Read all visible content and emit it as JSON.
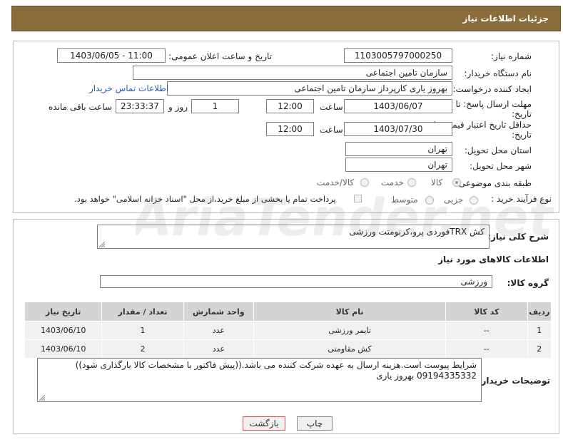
{
  "header": {
    "title": "جزئیات اطلاعات نیاز"
  },
  "form": {
    "need_number_label": "شماره نیاز:",
    "need_number": "1103005797000250",
    "announce_label": "تاریخ و ساعت اعلان عمومی:",
    "announce_value": "1403/06/05 - 11:00",
    "buyer_org_label": "نام دستگاه خریدار:",
    "buyer_org": "سازمان تامین اجتماعی",
    "requester_label": "ایجاد کننده درخواست:",
    "requester": "بهروز یاری کارپرداز سازمان تامین اجتماعی",
    "contact_link": "اطلاعات تماس خریدار",
    "reply_deadline_label_1": "مهلت ارسال پاسخ: تا",
    "reply_deadline_label_2": "تاریخ:",
    "reply_date": "1403/06/07",
    "time_label": "ساعت",
    "reply_time": "12:00",
    "days_value": "1",
    "days_label": "روز و",
    "remaining_value": "23:33:37",
    "remaining_label": "ساعت باقی مانده",
    "price_validity_label_1": "حداقل تاریخ اعتبار قیمت: تا",
    "price_validity_label_2": "تاریخ:",
    "price_date": "1403/07/30",
    "price_time": "12:00",
    "province_label": "استان محل تحویل:",
    "province": "تهران",
    "city_label": "شهر محل تحویل:",
    "city": "تهران",
    "category_label": "طبقه بندی موضوعی:",
    "category_options": [
      "کالا",
      "خدمت",
      "کالا/خدمت"
    ],
    "category_selected": "کالا",
    "process_label": "نوع فرآیند خرید :",
    "process_options": [
      "جزیی",
      "متوسط"
    ],
    "payment_note": "پرداخت تمام یا بخشی از مبلغ خرید،از محل \"اسناد خزانه اسلامی\" خواهد بود."
  },
  "description": {
    "label": "شرح کلی نیاز:",
    "text": "کش TRXفوردی پرو،کرنومتت ورزشی"
  },
  "goods": {
    "section_title": "اطلاعات کالاهای مورد نیاز",
    "group_label": "گروه کالا:",
    "group_value": "ورزشی",
    "columns": [
      "ردیف",
      "کد کالا",
      "نام کالا",
      "واحد شمارش",
      "تعداد / مقدار",
      "تاریخ نیاز"
    ],
    "rows": [
      {
        "row": "1",
        "code": "--",
        "name": "تایمر ورزشی",
        "unit": "عدد",
        "qty": "1",
        "date": "1403/06/10"
      },
      {
        "row": "2",
        "code": "--",
        "name": "کش مقاومتی",
        "unit": "عدد",
        "qty": "2",
        "date": "1403/06/10"
      }
    ]
  },
  "buyer_notes": {
    "label": "توضیحات خریدار:",
    "line1": "شرایط پیوست است.هزینه ارسال به عهده شرکت کننده می باشد.((پیش فاکتور با مشخصات کالا بارگذاری شود))",
    "line2": "09194335332 بهروز یاری"
  },
  "buttons": {
    "print": "چاپ",
    "back": "بازگشت"
  },
  "watermark": "AriaTender.net",
  "colors": {
    "header_bg": "#8a6d3b",
    "back_border": "#d9534f"
  }
}
